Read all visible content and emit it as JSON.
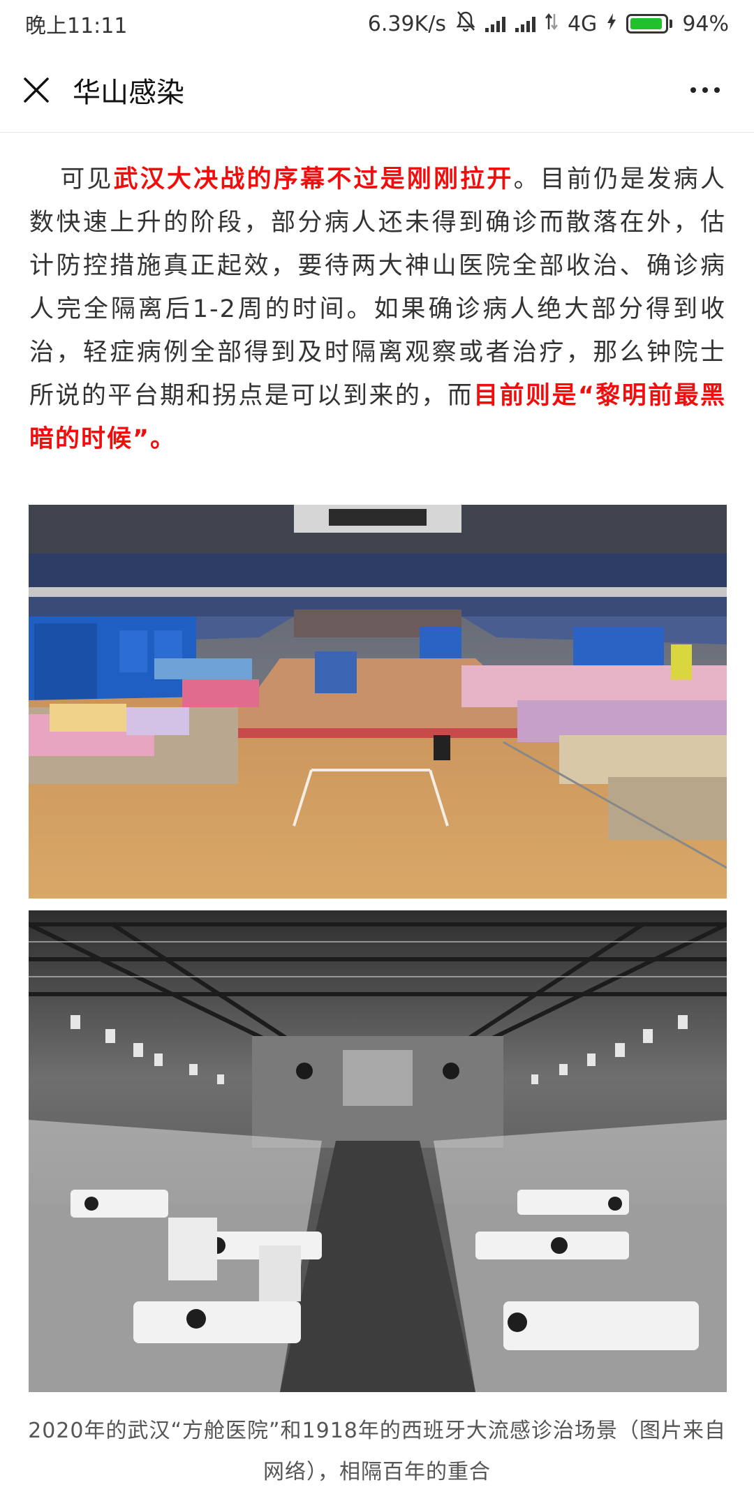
{
  "status_bar": {
    "time": "晚上11:11",
    "speed": "6.39K/s",
    "network": "4G",
    "battery_percent_text": "94%",
    "battery_level": 0.94,
    "battery_color": "#22c02a",
    "icons": [
      "mute-bell-icon",
      "signal-icon",
      "signal-icon",
      "data-transfer-icon",
      "charging-icon",
      "battery-icon"
    ]
  },
  "nav": {
    "title": "华山感染",
    "close_icon": "close-icon",
    "more_icon": "more-icon"
  },
  "article": {
    "segments": [
      {
        "text": "可见",
        "highlight": false
      },
      {
        "text": "武汉大决战的序幕不过是刚刚拉开",
        "highlight": true
      },
      {
        "text": "。目前仍是发病人数快速上升的阶段，部分病人还未得到确诊而散落在外，估计防控措施真正起效，要待两大神山医院全部收治、确诊病人完全隔离后1-2周的时间。如果确诊病人绝大部分得到收治，轻症病例全部得到及时隔离观察或者治疗，那么钟院士所说的平台期和拐点是可以到来的，而",
        "highlight": false
      },
      {
        "text": "目前则是“黎明前最黑暗的时候”。",
        "highlight": true
      }
    ],
    "highlight_color": "#f20d0d"
  },
  "images": {
    "top": "gymnasium-field-hospital-photo",
    "bottom": "1918-influenza-ward-photo"
  },
  "caption": "2020年的武汉“方舱医院”和1918年的西班牙大流感诊治场景（图片来自网络），相隔百年的重合"
}
